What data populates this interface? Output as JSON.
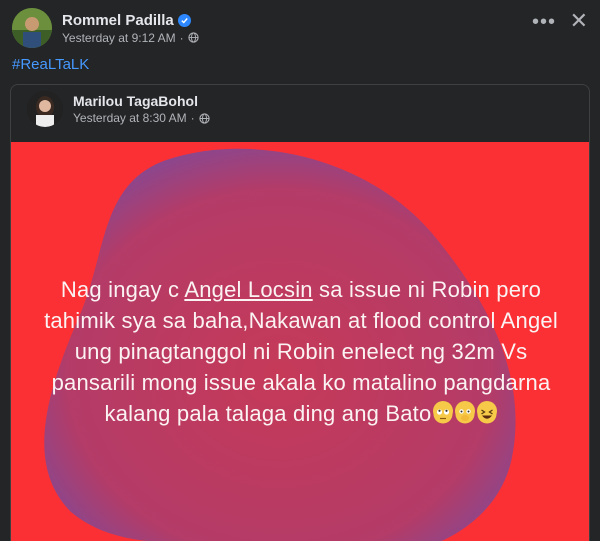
{
  "post": {
    "author": "Rommel Padilla",
    "timestamp": "Yesterday at 9:12 AM",
    "more_icon": "•••",
    "close_icon": "✕",
    "caption": "#ReaLTaLK"
  },
  "shared": {
    "author": "Marilou TagaBohol",
    "timestamp": "Yesterday at 8:30 AM",
    "background_color": "#fb3035",
    "text_before": "Nag ingay c ",
    "text_link": "Angel Locsin",
    "text_after": " sa issue ni Robin pero tahimik sya sa baha,Nakawan at flood control Angel ung pinagtanggol ni Robin enelect ng 32m Vs pansarili mong issue akala ko matalino pangdarna kalang pala talaga ding ang Bato",
    "emojis": [
      "face-with-rolling-eyes",
      "face-with-open-eyes-and-hand-over-mouth",
      "grinning-squinting-face"
    ]
  }
}
